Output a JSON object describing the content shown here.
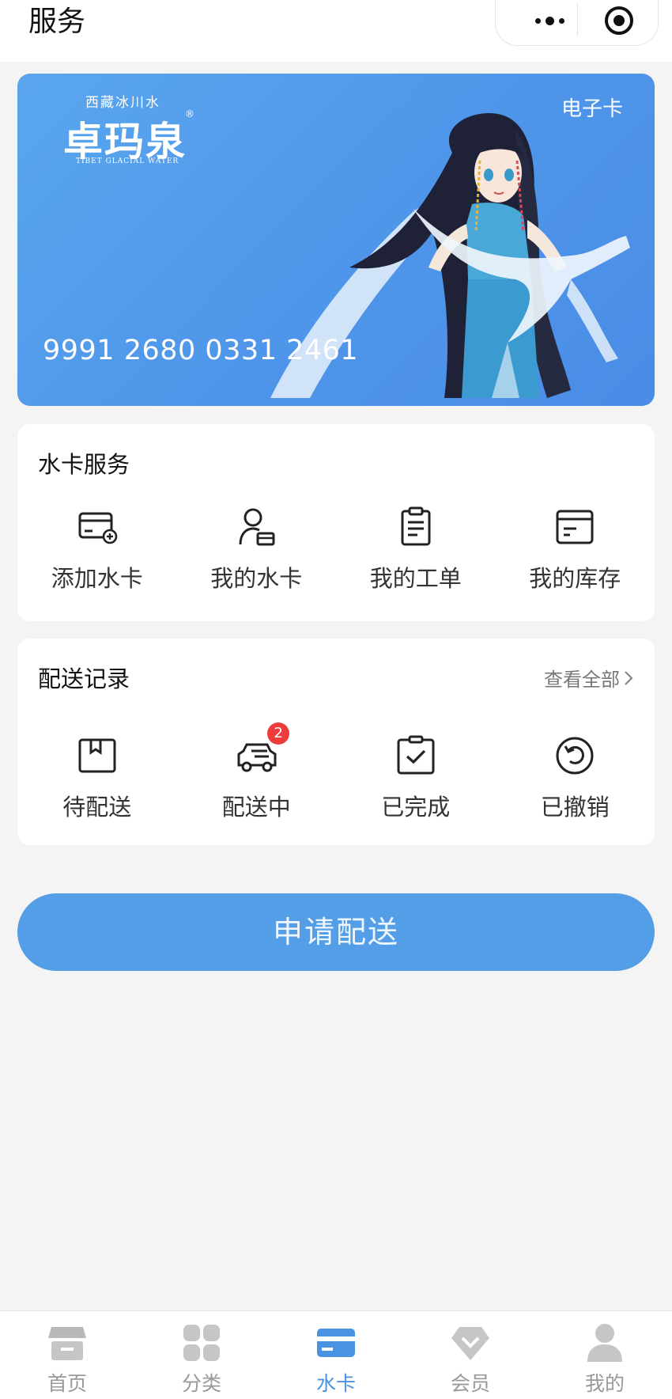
{
  "header": {
    "title": "服务"
  },
  "card": {
    "brand_top": "西藏冰川水",
    "brand_name": "卓玛泉",
    "brand_reg": "®",
    "brand_sub": "TIBET GLACIAL WATER",
    "type_label": "电子卡",
    "number": "9991 2680 0331 2461"
  },
  "water_card_service": {
    "title": "水卡服务",
    "items": [
      {
        "label": "添加水卡",
        "icon": "add-card-icon"
      },
      {
        "label": "我的水卡",
        "icon": "user-card-icon"
      },
      {
        "label": "我的工单",
        "icon": "clipboard-icon"
      },
      {
        "label": "我的库存",
        "icon": "box-icon"
      }
    ]
  },
  "delivery_records": {
    "title": "配送记录",
    "view_all": "查看全部",
    "items": [
      {
        "label": "待配送",
        "icon": "package-icon"
      },
      {
        "label": "配送中",
        "icon": "truck-icon",
        "badge": "2"
      },
      {
        "label": "已完成",
        "icon": "check-clipboard-icon"
      },
      {
        "label": "已撤销",
        "icon": "undo-icon"
      }
    ]
  },
  "apply_button": "申请配送",
  "tabbar": {
    "active": "水卡",
    "items": [
      {
        "label": "首页",
        "icon": "store-icon"
      },
      {
        "label": "分类",
        "icon": "grid-icon"
      },
      {
        "label": "水卡",
        "icon": "card-icon"
      },
      {
        "label": "会员",
        "icon": "diamond-icon"
      },
      {
        "label": "我的",
        "icon": "person-icon"
      }
    ]
  },
  "colors": {
    "accent": "#4a93e2",
    "button": "#539ee6",
    "badge": "#ee3b3b",
    "card_bg": "#4f97ea"
  }
}
